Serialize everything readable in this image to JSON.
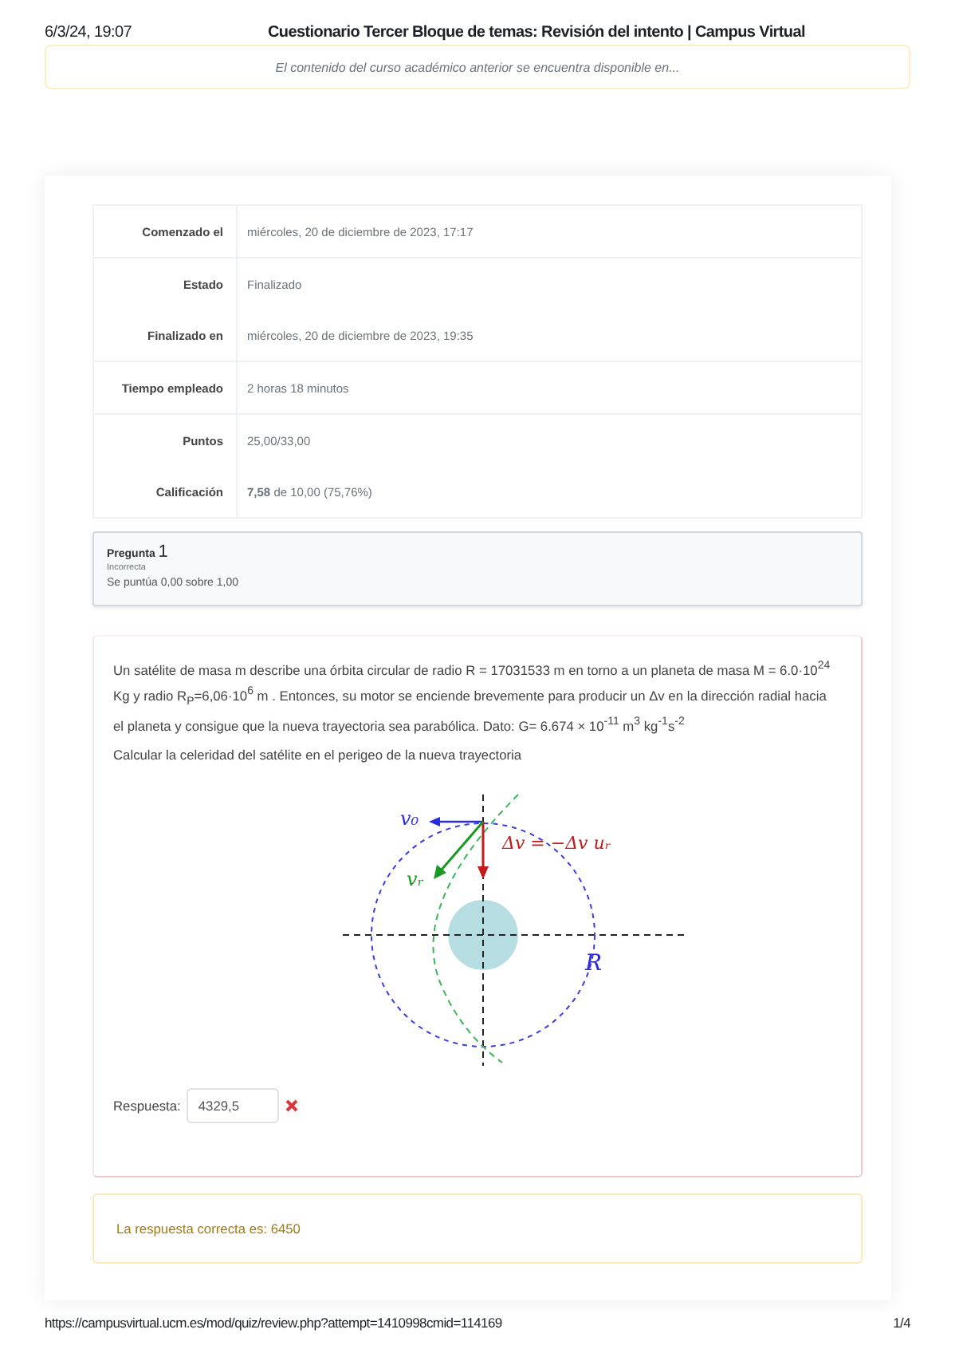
{
  "print_header": {
    "date": "6/3/24, 19:07",
    "title": "Cuestionario Tercer Bloque de temas: Revisión del intento | Campus Virtual"
  },
  "notice": "El contenido del curso académico anterior se encuentra disponible en...",
  "summary": [
    {
      "label": "Comenzado el",
      "value": "miércoles, 20 de diciembre de 2023, 17:17"
    },
    {
      "label": "Estado",
      "value": "Finalizado"
    },
    {
      "label": "Finalizado en",
      "value": "miércoles, 20 de diciembre de 2023, 19:35"
    },
    {
      "label": "Tiempo empleado",
      "value": "2 horas 18 minutos"
    },
    {
      "label": "Puntos",
      "value": "25,00/33,00"
    },
    {
      "label": "Calificación",
      "value": "**7,58** de 10,00 (75,76%)"
    }
  ],
  "question_info": {
    "prefix": "Pregunta",
    "number": "1",
    "status": "Incorrecta",
    "grade": "Se puntúa 0,00 sobre 1,00"
  },
  "question": {
    "text": "Un satélite de masa m describe una órbita circular de radio R = 17031533 m en torno a un planeta de masa M = 6.0·10$^{24}$ Kg  y radio R$_{P}$=6,06·10$^{6}$ m . Entonces, su motor se enciende brevemente para producir un Δv en la dirección radial hacia el planeta y consigue que la nueva trayectoria sea parabólica. Dato: G= 6.674 × 10$^{-11}$ m$^{3}$ kg$^{-1}$s$^{-2}$",
    "prompt": "Calcular la celeridad del satélite en el perigeo de la nueva trayectoria",
    "diagram": {
      "v0": "v₀",
      "dv": "Δv = −Δv uᵣ",
      "vr": "vᵣ",
      "radius": "R"
    },
    "answer_label": "Respuesta:",
    "answer_value": "4329,5",
    "correct": false
  },
  "feedback": "La respuesta correcta es: 6450",
  "print_footer": {
    "url": "https://campusvirtual.ucm.es/mod/quiz/review.php?attempt=1410998cmid=114169",
    "page": "1/4"
  }
}
